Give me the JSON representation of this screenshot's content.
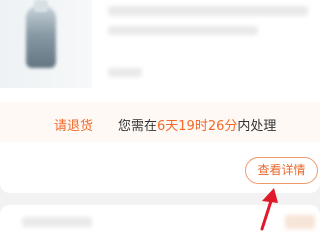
{
  "order_card": {
    "notice": {
      "label": "请退货",
      "prefix": "您需在",
      "countdown": "6天19时26分",
      "suffix": "内处理"
    },
    "detail_button_label": "查看详情"
  },
  "colors": {
    "accent": "#f2692a",
    "annotation_arrow": "#e0192b"
  },
  "icons": {
    "product_image": "medicine-bottle",
    "annotation": "red-arrow"
  }
}
